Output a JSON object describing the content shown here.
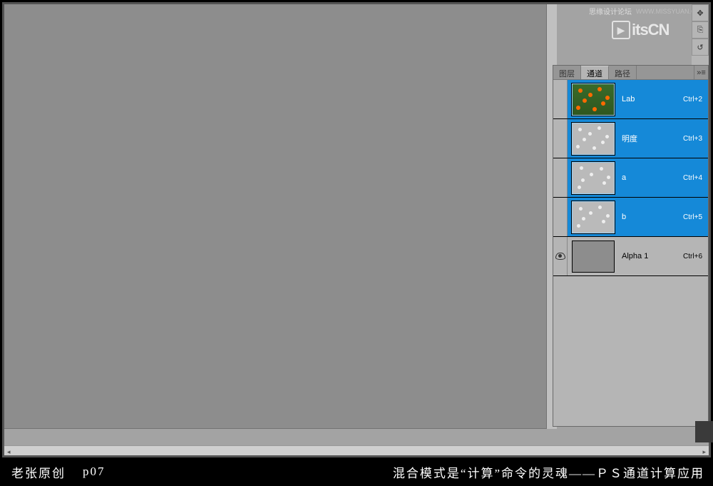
{
  "watermark": {
    "site_cn": "思缘设计论坛",
    "site_url": "WWW.MISSYUAN.COM",
    "logo_text": "itsCN"
  },
  "toolstrip": {
    "tools": [
      "✥",
      "⎘",
      "↺"
    ]
  },
  "panel": {
    "tabs": [
      "图层",
      "通道",
      "路径"
    ],
    "active_tab_index": 1,
    "menu_glyph": "»≡"
  },
  "channels": [
    {
      "name": "Lab",
      "shortcut": "Ctrl+2",
      "selected": true,
      "thumb": "color",
      "eye": false
    },
    {
      "name": "明度",
      "shortcut": "Ctrl+3",
      "selected": true,
      "thumb": "gray",
      "eye": false
    },
    {
      "name": "a",
      "shortcut": "Ctrl+4",
      "selected": true,
      "thumb": "gray",
      "eye": false
    },
    {
      "name": "b",
      "shortcut": "Ctrl+5",
      "selected": true,
      "thumb": "gray",
      "eye": false
    },
    {
      "name": "Alpha 1",
      "shortcut": "Ctrl+6",
      "selected": false,
      "thumb": "solid",
      "eye": true
    }
  ],
  "caption": {
    "author": "老张原创",
    "page": "p07",
    "text": "混合模式是“计算”命令的灵魂——ＰＳ通道计算应用"
  }
}
